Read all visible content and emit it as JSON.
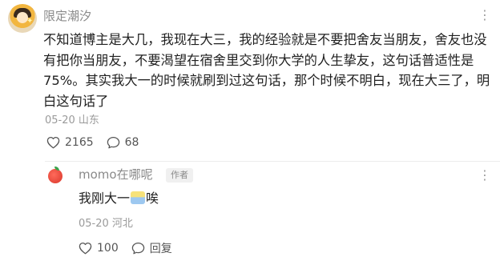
{
  "main_comment": {
    "username": "限定潮汐",
    "text": "不知道博主是大几，我现在大三，我的经验就是不要把舍友当朋友，舍友也没有把你当朋友，不要渴望在宿舍里交到你大学的人生挚友，这句话普适性是75%。其实我大一的时候就刷到过这句话，那个时候不明白，现在大三了，明白这句话了",
    "date": "05-20",
    "location": "山东",
    "likes": "2165",
    "replies": "68"
  },
  "reply": {
    "username": "momo在哪呢",
    "badge": "作者",
    "text_before": "我刚大一",
    "text_after": "唉",
    "date": "05-20",
    "location": "河北",
    "likes": "100",
    "reply_label": "回复"
  },
  "icons": {
    "more": "more-dots-icon",
    "like": "heart-icon",
    "comment": "comment-bubble-icon"
  },
  "colors": {
    "secondary_text": "#8a8a8a",
    "body_text": "#1f1f1f"
  }
}
